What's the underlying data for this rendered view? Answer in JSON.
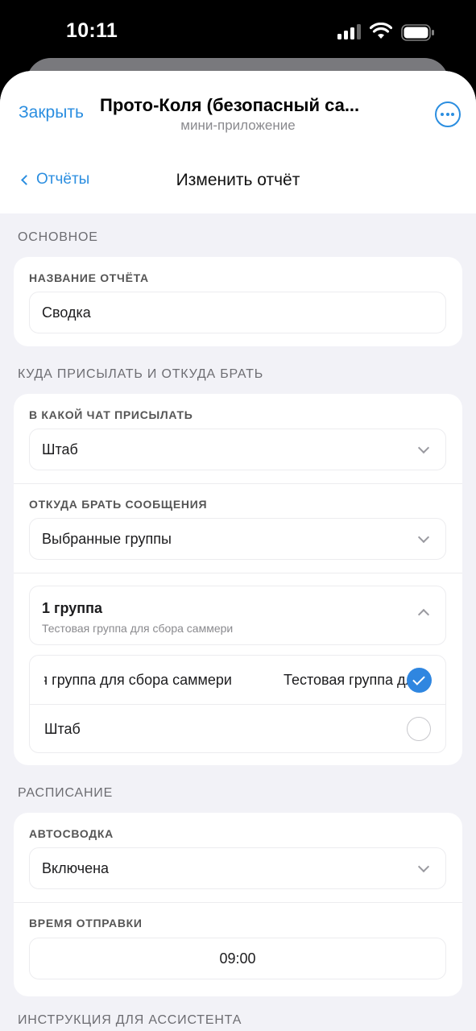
{
  "status_bar": {
    "time": "10:11",
    "icons": [
      "signal-icon",
      "wifi-icon",
      "battery-icon"
    ]
  },
  "header": {
    "close_label": "Закрыть",
    "app_title": "Прото-Коля (безопасный са...",
    "app_subtitle": "мини-приложение",
    "more_icon": "more-icon"
  },
  "nav": {
    "back_label": "Отчёты",
    "page_title": "Изменить отчёт"
  },
  "sections": {
    "basic": {
      "title": "ОСНОВНОЕ",
      "report_name_label": "НАЗВАНИЕ ОТЧЁТА",
      "report_name_value": "Сводка"
    },
    "delivery": {
      "title": "КУДА ПРИСЫЛАТЬ И ОТКУДА БРАТЬ",
      "chat_label": "В КАКОЙ ЧАТ ПРИСЫЛАТЬ",
      "chat_value": "Штаб",
      "source_label": "ОТКУДА БРАТЬ СООБЩЕНИЯ",
      "source_value": "Выбранные группы",
      "groups_count": "1 группа",
      "groups_desc": "Тестовая группа для сбора саммери",
      "groups": [
        {
          "label": "Тестовая группа для сбора саммери",
          "checked": true
        },
        {
          "label": "Штаб",
          "checked": false
        }
      ]
    },
    "schedule": {
      "title": "РАСПИСАНИЕ",
      "autosummary_label": "АВТОСВОДКА",
      "autosummary_value": "Включена",
      "send_time_label": "ВРЕМЯ ОТПРАВКИ",
      "send_time_value": "09:00"
    },
    "assistant": {
      "title": "ИНСТРУКЦИЯ ДЛЯ АССИСТЕНТА"
    }
  },
  "colors": {
    "accent": "#2b8ee0",
    "background": "#f2f2f7",
    "check_active": "#2f86e0"
  }
}
